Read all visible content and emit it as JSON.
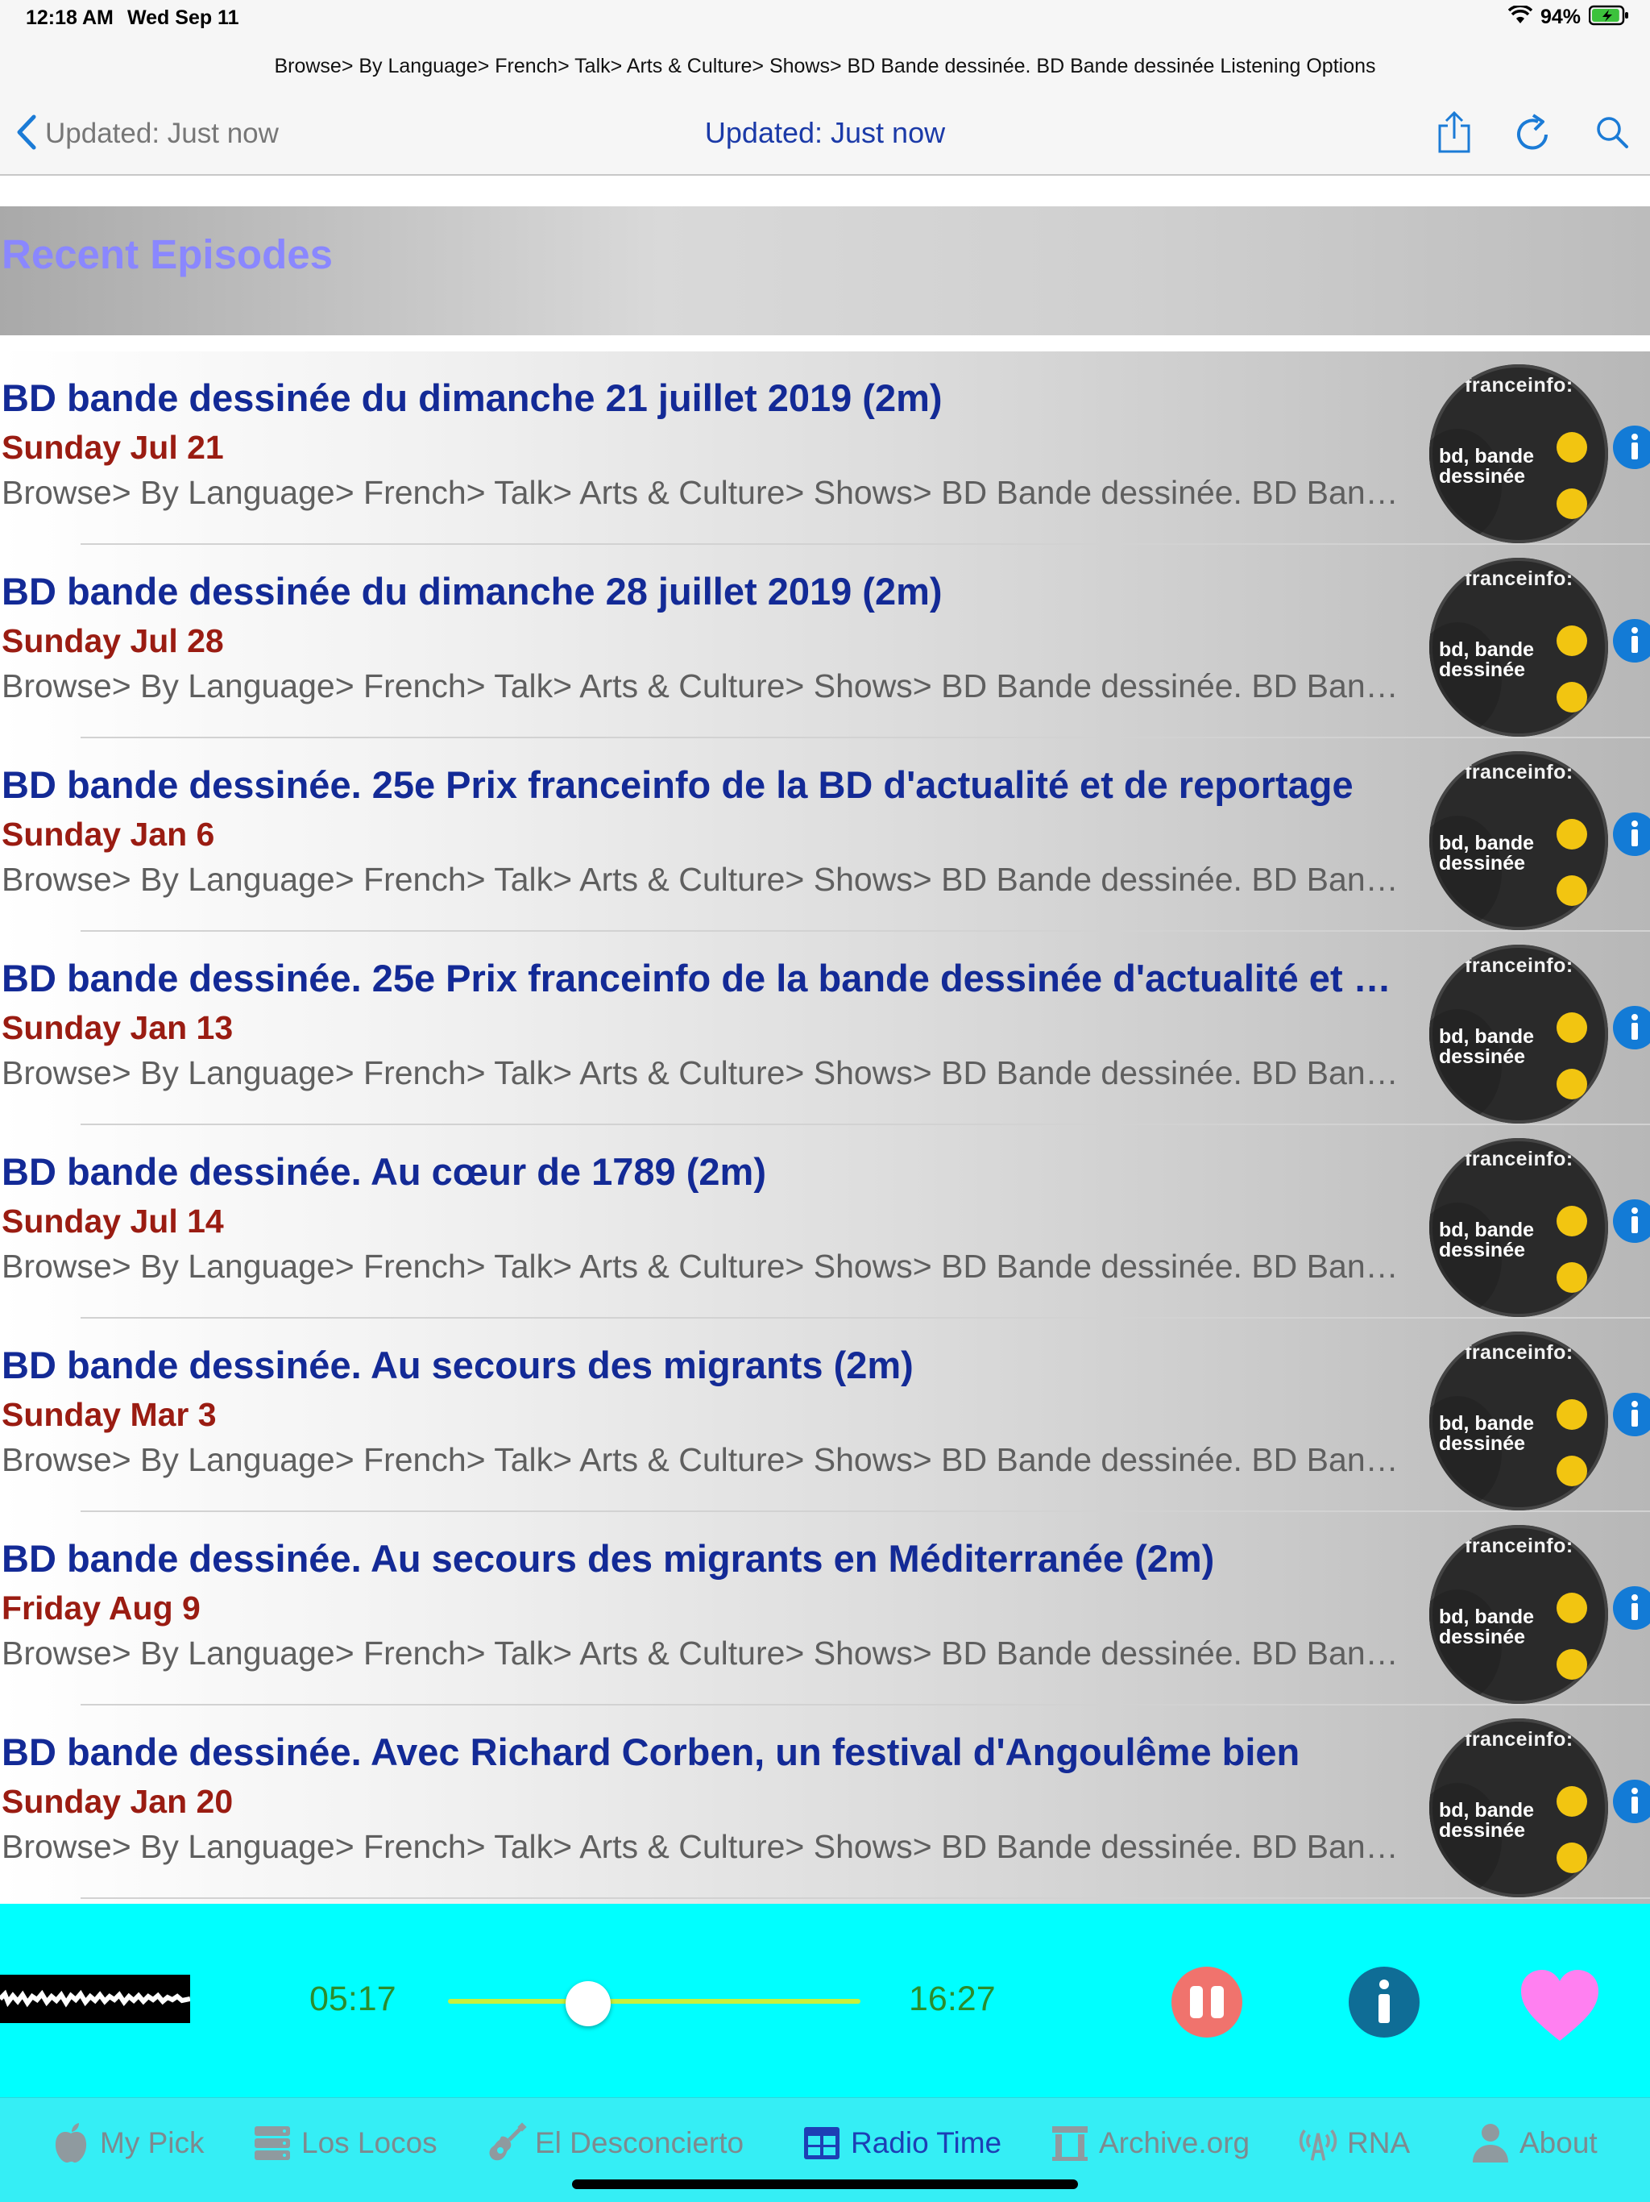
{
  "status_bar": {
    "time": "12:18 AM",
    "date": "Wed Sep 11",
    "battery_percent": "94%",
    "battery_level": 0.94,
    "battery_color": "#3cc23c"
  },
  "nav": {
    "breadcrumb": "Browse> By Language> French> Talk> Arts & Culture> Shows> BD Bande dessinée. BD Bande dessinée Listening Options",
    "back_label": "Updated: Just now",
    "title": "Updated: Just now",
    "icons": [
      "share-icon",
      "refresh-icon",
      "search-icon"
    ],
    "accent_color": "#1b7bd6"
  },
  "section": {
    "title": "Recent Episodes"
  },
  "episodes": [
    {
      "title": "BD bande dessinée du dimanche 21 juillet 2019 (2m)",
      "date": "Sunday Jul 21",
      "path": "Browse> By Language> French> Talk> Arts & Culture> Shows> BD Bande dessinée. BD Bande dessinée"
    },
    {
      "title": "BD bande dessinée du dimanche 28 juillet 2019 (2m)",
      "date": "Sunday Jul 28",
      "path": "Browse> By Language> French> Talk> Arts & Culture> Shows> BD Bande dessinée. BD Bande dessinée"
    },
    {
      "title": "BD bande dessinée. 25e Prix franceinfo de la BD d'actualité et de reportage",
      "date": "Sunday Jan 6",
      "path": "Browse> By Language> French> Talk> Arts & Culture> Shows> BD Bande dessinée. BD Bande dessinée"
    },
    {
      "title": "BD bande dessinée. 25e Prix franceinfo de la bande dessinée d'actualité et de reportage",
      "date": "Sunday Jan 13",
      "path": "Browse> By Language> French> Talk> Arts & Culture> Shows> BD Bande dessinée. BD Bande dessinée"
    },
    {
      "title": "BD bande dessinée. Au cœur de 1789 (2m)",
      "date": "Sunday Jul 14",
      "path": "Browse> By Language> French> Talk> Arts & Culture> Shows> BD Bande dessinée. BD Bande dessinée"
    },
    {
      "title": "BD bande dessinée. Au secours des migrants (2m)",
      "date": "Sunday Mar 3",
      "path": "Browse> By Language> French> Talk> Arts & Culture> Shows> BD Bande dessinée. BD Bande dessinée"
    },
    {
      "title": "BD bande dessinée. Au secours des migrants en Méditerranée (2m)",
      "date": "Friday Aug 9",
      "path": "Browse> By Language> French> Talk> Arts & Culture> Shows> BD Bande dessinée. BD Bande dessinée"
    },
    {
      "title": "BD bande dessinée. Avec Richard Corben, un festival d'Angoulême bien",
      "date": "Sunday Jan 20",
      "path": "Browse> By Language> French> Talk> Arts & Culture> Shows> BD Bande dessinée. BD Bande dessinée"
    }
  ],
  "thumbnail": {
    "brand": "franceinfo:",
    "show_line1": "bd, bande",
    "show_line2": "dessinée"
  },
  "player": {
    "elapsed": "05:17",
    "total": "16:27",
    "progress_fraction": 0.32,
    "background_color": "#00ffff",
    "pause_color": "#f0736d",
    "info_color": "#0f6d96",
    "heart_color": "#ff80f0"
  },
  "tabs": [
    {
      "label": "My Pick",
      "icon": "apple-icon",
      "active": false
    },
    {
      "label": "Los Locos",
      "icon": "server-icon",
      "active": false
    },
    {
      "label": "El Desconcierto",
      "icon": "guitar-icon",
      "active": false
    },
    {
      "label": "Radio Time",
      "icon": "grid-icon",
      "active": true
    },
    {
      "label": "Archive.org",
      "icon": "archive-icon",
      "active": false
    },
    {
      "label": "RNA",
      "icon": "antenna-icon",
      "active": false
    },
    {
      "label": "About",
      "icon": "person-icon",
      "active": false
    }
  ]
}
